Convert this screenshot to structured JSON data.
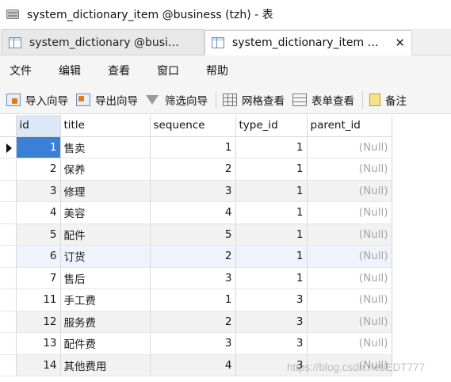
{
  "window": {
    "title": "system_dictionary_item @business (tzh) - 表"
  },
  "tabs": [
    {
      "label": "system_dictionary @busi…",
      "active": false
    },
    {
      "label": "system_dictionary_item …",
      "active": true,
      "close": "✕"
    }
  ],
  "menu": [
    "文件",
    "编辑",
    "查看",
    "窗口",
    "帮助"
  ],
  "toolbar": {
    "import_label": "导入向导",
    "export_label": "导出向导",
    "filter_label": "筛选向导",
    "grid_label": "网格查看",
    "form_label": "表单查看",
    "note_label": "备注"
  },
  "table": {
    "columns": [
      "id",
      "title",
      "sequence",
      "type_id",
      "parent_id"
    ],
    "rows": [
      [
        "1",
        "售卖",
        "1",
        "1",
        "(Null)"
      ],
      [
        "2",
        "保养",
        "2",
        "1",
        "(Null)"
      ],
      [
        "3",
        "修理",
        "3",
        "1",
        "(Null)"
      ],
      [
        "4",
        "美容",
        "4",
        "1",
        "(Null)"
      ],
      [
        "5",
        "配件",
        "5",
        "1",
        "(Null)"
      ],
      [
        "6",
        "订货",
        "2",
        "1",
        "(Null)"
      ],
      [
        "7",
        "售后",
        "3",
        "1",
        "(Null)"
      ],
      [
        "11",
        "手工费",
        "1",
        "3",
        "(Null)"
      ],
      [
        "12",
        "服务费",
        "2",
        "3",
        "(Null)"
      ],
      [
        "13",
        "配件费",
        "3",
        "3",
        "(Null)"
      ],
      [
        "14",
        "其他费用",
        "4",
        "3",
        "(Null)"
      ]
    ]
  },
  "watermark": "https://blog.csdn.net/EDT777",
  "colors": {
    "selected_cell": "#3b7fd6",
    "header_highlight": "#dce8f6",
    "null_text": "#a6a6a6"
  }
}
